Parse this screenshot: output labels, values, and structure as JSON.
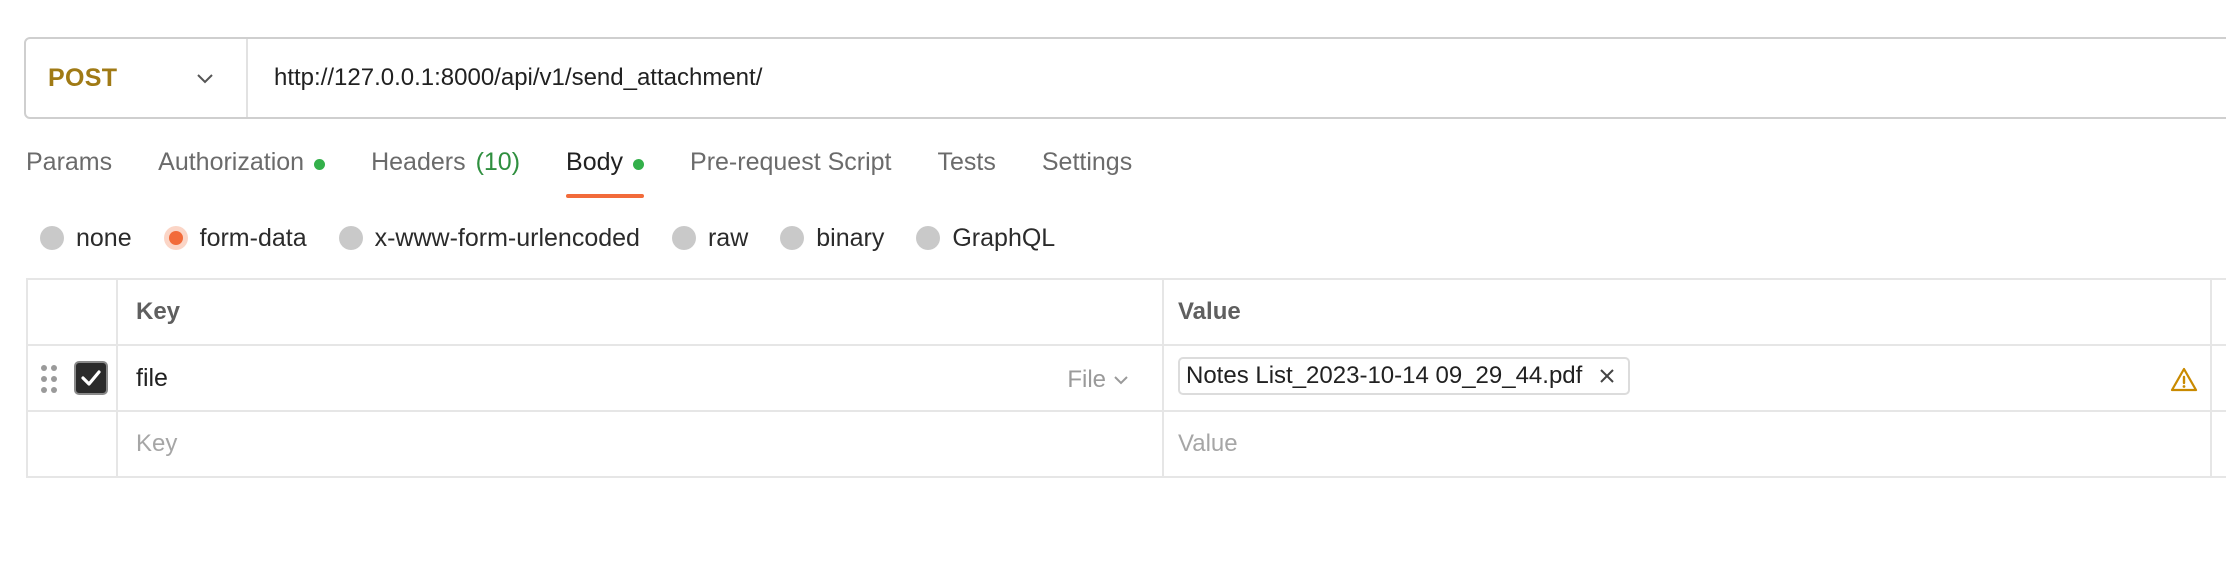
{
  "request": {
    "method": "POST",
    "url": "http://127.0.0.1:8000/api/v1/send_attachment/"
  },
  "tabs": [
    {
      "label": "Params"
    },
    {
      "label": "Authorization"
    },
    {
      "label": "Headers",
      "count": "(10)"
    },
    {
      "label": "Body"
    },
    {
      "label": "Pre-request Script"
    },
    {
      "label": "Tests"
    },
    {
      "label": "Settings"
    }
  ],
  "body_types": {
    "options": [
      "none",
      "form-data",
      "x-www-form-urlencoded",
      "raw",
      "binary",
      "GraphQL"
    ],
    "selected": "form-data"
  },
  "table": {
    "headers": {
      "key": "Key",
      "value": "Value"
    },
    "rows": [
      {
        "key": "file",
        "type": "File",
        "value": "Notes List_2023-10-14 09_29_44.pdf"
      }
    ],
    "new_row": {
      "key_placeholder": "Key",
      "value_placeholder": "Value"
    }
  },
  "colors": {
    "method": "#a07a15",
    "accent": "#f26b3a",
    "status_dot": "#33b04a",
    "warning": "#c98a00"
  },
  "icons": [
    "chevron-down-icon",
    "drag-handle-icon",
    "checkmark-icon",
    "close-icon",
    "warning-icon"
  ]
}
